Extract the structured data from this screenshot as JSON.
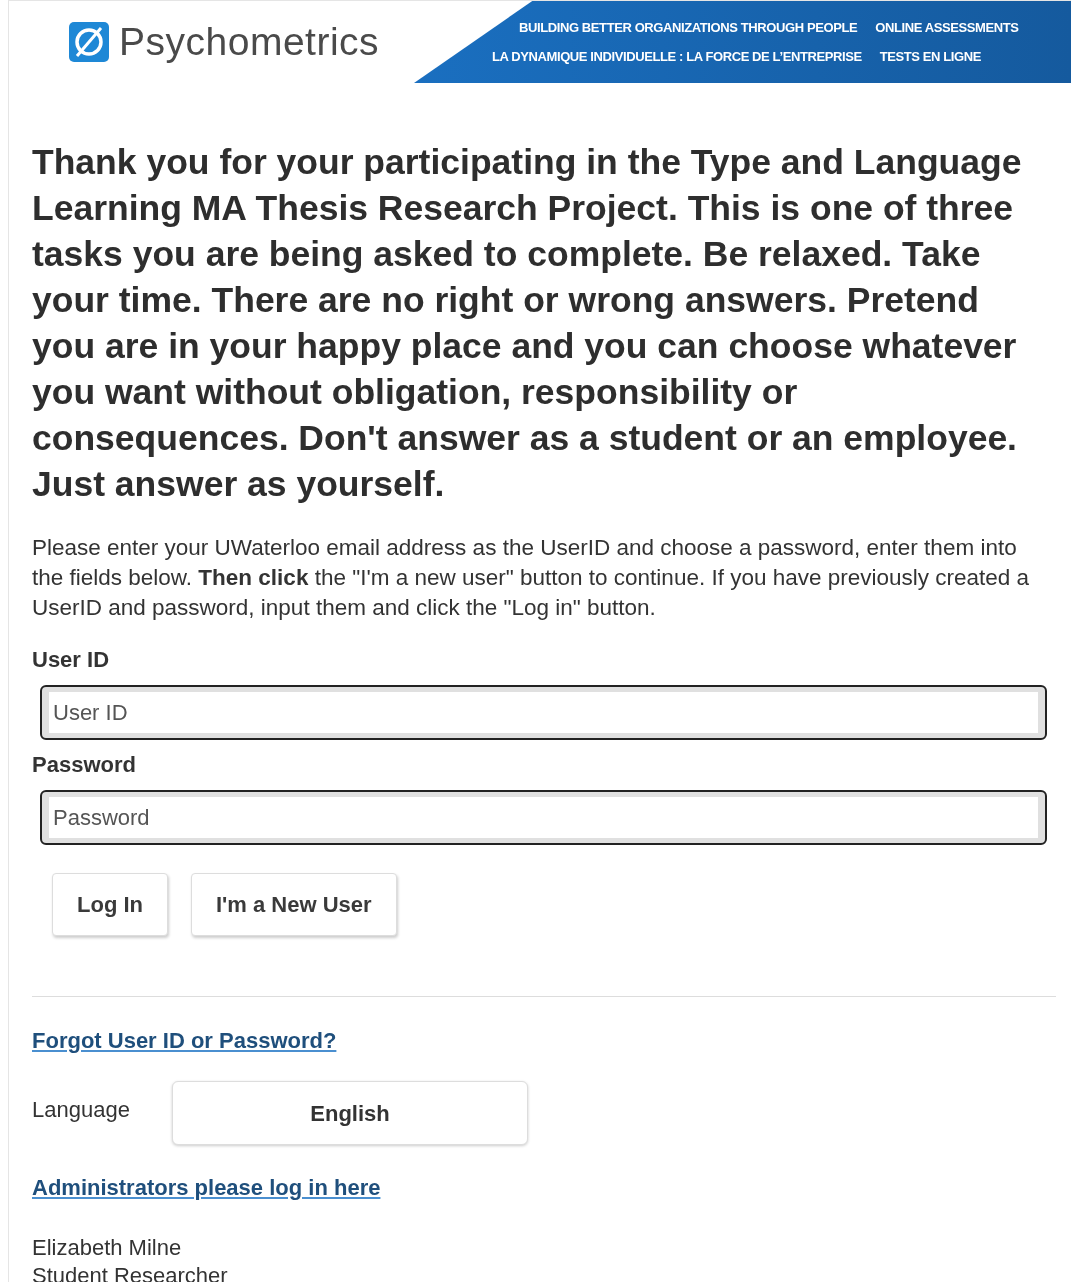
{
  "header": {
    "logo_text": "Psychometrics",
    "banner": [
      [
        "BUILDING BETTER ORGANIZATIONS THROUGH PEOPLE",
        "ONLINE ASSESSMENTS"
      ],
      [
        "LA DYNAMIQUE INDIVIDUELLE : LA FORCE DE L’ENTREPRISE",
        "TESTS EN LIGNE"
      ]
    ]
  },
  "intro": "Thank you for your participating in the Type and Language Learning MA Thesis Research Project. This is one of three tasks you are being asked to complete. Be relaxed. Take your time. There are no right or wrong answers. Pretend you are in your happy place and you can choose whatever you want without obligation, responsibility or consequences. Don't answer as a student or an employee. Just answer as yourself.",
  "instructions": "Please enter your UWaterloo email address as the UserID and choose a password, enter them into the fields below. **Then click** the \"I'm a new user\" button to continue. If you have previously created a UserID and password, input them and click the \"Log in\" button.",
  "fields": [
    {
      "label": "User ID",
      "placeholder": "User ID"
    },
    {
      "label": "Password",
      "placeholder": "Password"
    }
  ],
  "buttons": [
    "Log In",
    "I'm a New User"
  ],
  "forgot_link": "Forgot User ID or Password?",
  "language": {
    "label": "Language",
    "value": "English"
  },
  "admin_link": "Administrators please log in here",
  "footer": [
    "Elizabeth Milne",
    "Student Researcher"
  ]
}
